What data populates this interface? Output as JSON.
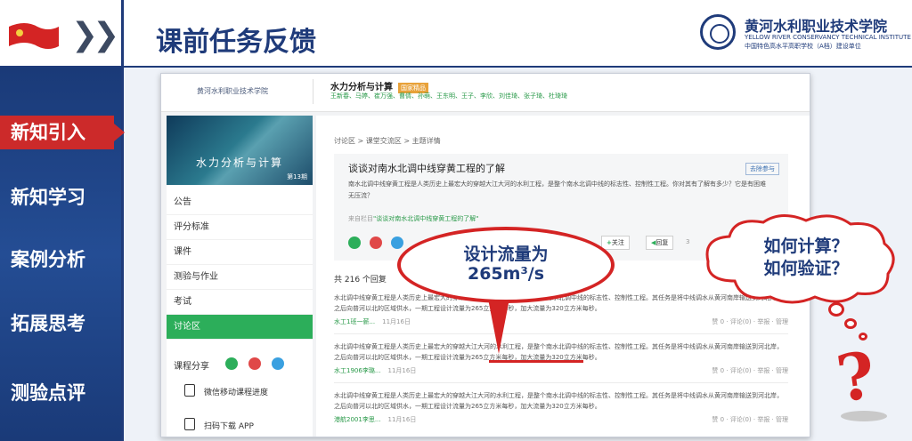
{
  "header": {
    "title": "课前任务反馈",
    "logo_cn": "黄河水利职业技术学院",
    "logo_en": "YELLOW RIVER CONSERVANCY TECHNICAL INSTITUTE",
    "logo_sub": "中国特色高水平高职学校（A档）建设单位"
  },
  "nav": {
    "items": [
      {
        "label": "新知引入",
        "active": true
      },
      {
        "label": "新知学习",
        "active": false
      },
      {
        "label": "案例分析",
        "active": false
      },
      {
        "label": "拓展思考",
        "active": false
      },
      {
        "label": "测验点评",
        "active": false
      }
    ]
  },
  "screenshot": {
    "site_logo": "黄河水利职业技术学院",
    "course_title": "水力分析与计算",
    "course_tag": "国家精品",
    "teachers": "王新春、马婷、崔万强、曹倩、孙萌、王东明、王子、李欣、刘佳琦、张子琦、杜琦琦",
    "cover_title": "水力分析与计算",
    "cover_num": "第13期",
    "menu": [
      "公告",
      "评分标准",
      "课件",
      "测验与作业",
      "考试",
      "讨论区"
    ],
    "menu_active": "讨论区",
    "share_label": "课程分享",
    "side_links": [
      "微信移动课程进度",
      "扫码下载 APP"
    ],
    "breadcrumb": [
      "讨论区",
      "课堂交流区",
      "主题详情"
    ],
    "post": {
      "title": "谈谈对南水北调中线穿黄工程的了解",
      "button": "去除参与",
      "text": "南水北调中线穿黄工程是人类历史上最宏大的穿越大江大河的水利工程，是整个南水北调中线的标志性、控制性工程。你对其有了解有多少？它是有困难无压流？",
      "from_prefix": "来自栏目",
      "from_link": "\"谈谈对南水北调中线穿黄工程的了解\"",
      "follow": "关注",
      "reply": "回复",
      "count": "3"
    },
    "replies_label": "共 216 个回复",
    "sort_label": "排序",
    "replies": [
      {
        "text": "水北调中线穿黄工程是人类历史上最宏大的穿越大江大河的水利工程，是整个南水北调中线的标志性、控制性工程。其任务是将中线调水从黄河南岸输送到河北岸，之后向普河以北的区域供水，一期工程设计流量为265立方米每秒，加大流量为320立方米每秒。",
        "user": "水工1班一薪...",
        "date": "11月16日",
        "actions": "赞 0 · 评论(0) · 举报 · 管理"
      },
      {
        "text": "水北调中线穿黄工程是人类历史上最宏大的穿越大江大河的水利工程，是整个南水北调中线的标志性、控制性工程。其任务是将中线调水从黄河南岸输送到河北岸，之后向普河以北的区域供水，一期工程设计流量为265立方米每秒，加大流量为320立方米每秒。",
        "user": "水工1906李璐...",
        "date": "11月16日",
        "actions": "赞 0 · 评论(0) · 举报 · 管理"
      },
      {
        "text": "水北调中线穿黄工程是人类历史上最宏大的穿越大江大河的水利工程，是整个南水北调中线的标志性、控制性工程。其任务是将中线调水从黄河南岸输送到河北岸，之后向普河以北的区域供水，一期工程设计流量为265立方米每秒，加大流量为320立方米每秒。",
        "user": "港航2001李思...",
        "date": "11月16日",
        "actions": "赞 0 · 评论(0) · 举报 · 管理"
      }
    ]
  },
  "callout": {
    "line1": "设计流量为",
    "line2": "265m³/s"
  },
  "cloud": {
    "line1": "如何计算？",
    "line2": "如何验证？"
  },
  "colors": {
    "navy": "#1f3b7a",
    "red": "#d42424",
    "green": "#2cae5a"
  }
}
